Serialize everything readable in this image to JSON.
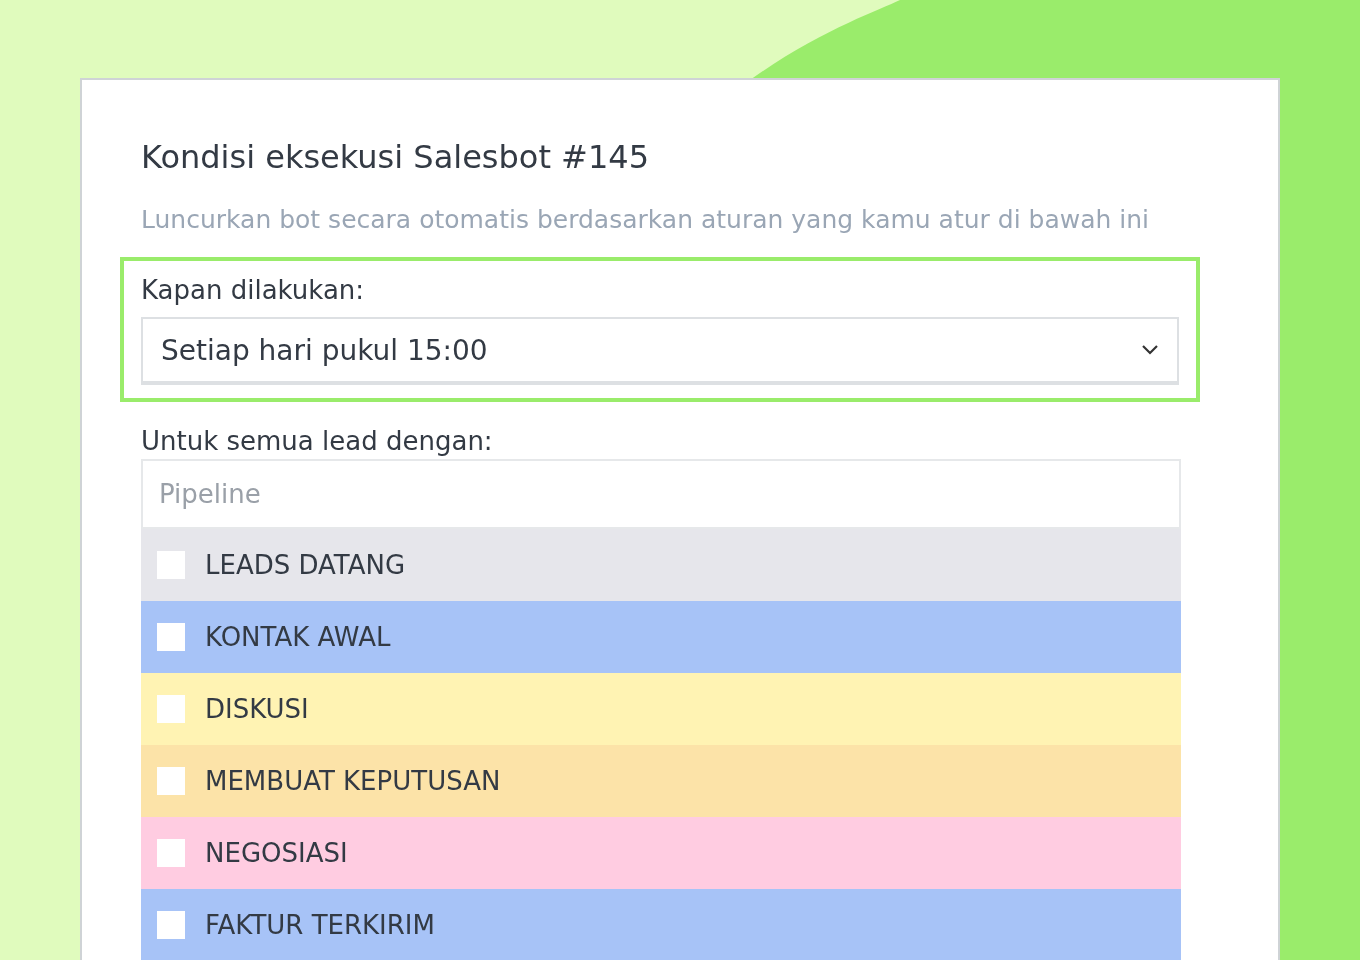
{
  "title": "Kondisi eksekusi Salesbot #145",
  "subtitle": "Luncurkan bot secara otomatis berdasarkan aturan yang kamu atur di bawah ini",
  "schedule": {
    "label": "Kapan dilakukan:",
    "value": "Setiap hari pukul 15:00"
  },
  "filter": {
    "label": "Untuk semua lead dengan:",
    "placeholder": "Pipeline"
  },
  "stages": [
    {
      "label": "LEADS DATANG",
      "color": "#e6e6eb",
      "checked": false
    },
    {
      "label": "KONTAK AWAL",
      "color": "#a7c3f7",
      "checked": false
    },
    {
      "label": "DISKUSI",
      "color": "#fff3b3",
      "checked": false
    },
    {
      "label": "MEMBUAT KEPUTUSAN",
      "color": "#fce3a8",
      "checked": false
    },
    {
      "label": "NEGOSIASI",
      "color": "#ffcce1",
      "checked": false
    },
    {
      "label": "FAKTUR TERKIRIM",
      "color": "#a7c3f7",
      "checked": false
    }
  ]
}
